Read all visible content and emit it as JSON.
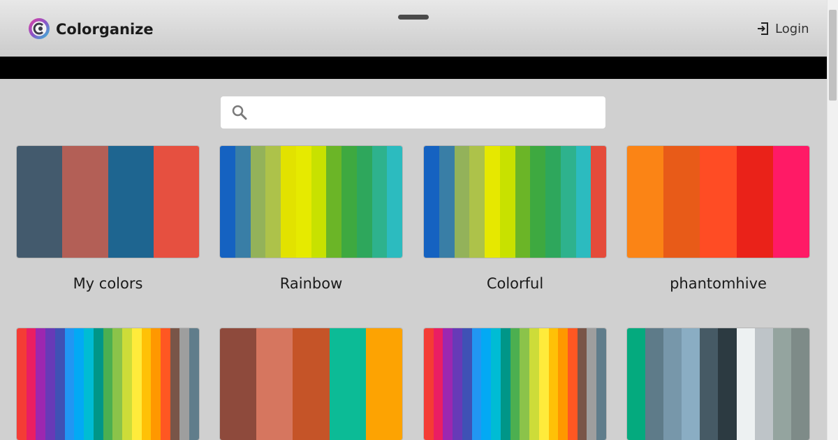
{
  "header": {
    "brand": "Colorganize",
    "login_label": "Login"
  },
  "search": {
    "placeholder": "",
    "value": ""
  },
  "palettes": [
    {
      "name": "My colors",
      "colors": [
        "#435a6d",
        "#b35f56",
        "#1e6590",
        "#e65040"
      ]
    },
    {
      "name": "Rainbow",
      "colors": [
        "#1562c1",
        "#397ea6",
        "#93b25a",
        "#adc24a",
        "#e2e200",
        "#e6ea00",
        "#c8e100",
        "#6bb527",
        "#3ea940",
        "#2ea75c",
        "#2eb28d",
        "#2cbbbf"
      ]
    },
    {
      "name": "Colorful",
      "colors": [
        "#1562c1",
        "#397ea6",
        "#93b25a",
        "#adc24a",
        "#e6e800",
        "#c8e100",
        "#6bb527",
        "#3ea940",
        "#2ea75c",
        "#2eb28d",
        "#2cbbbf",
        "#e54b3a"
      ]
    },
    {
      "name": "phantomhive",
      "colors": [
        "#fb8415",
        "#e85b18",
        "#ff4c24",
        "#ea2219",
        "#ff1a66"
      ]
    },
    {
      "name": "",
      "colors": [
        "#f43c35",
        "#ea1e63",
        "#9c27b0",
        "#673ab7",
        "#3f51b5",
        "#2196f3",
        "#03a9f4",
        "#00bcd4",
        "#009688",
        "#4caf50",
        "#8bc34a",
        "#cddc39",
        "#ffeb3b",
        "#ffc107",
        "#ff9800",
        "#ff5722",
        "#795548",
        "#9e9e9e",
        "#607d8b"
      ]
    },
    {
      "name": "",
      "colors": [
        "#8e4a3c",
        "#d6765f",
        "#c55428",
        "#0cbb96",
        "#fda302"
      ]
    },
    {
      "name": "",
      "colors": [
        "#f43c35",
        "#ea1e63",
        "#9c27b0",
        "#673ab7",
        "#3f51b5",
        "#2196f3",
        "#03a9f4",
        "#00bcd4",
        "#009688",
        "#4caf50",
        "#8bc34a",
        "#cddc39",
        "#ffeb3b",
        "#ffc107",
        "#ff9800",
        "#ff5722",
        "#795548",
        "#9e9e9e",
        "#607d8b"
      ]
    },
    {
      "name": "",
      "colors": [
        "#04aa7e",
        "#5e7b89",
        "#7797aa",
        "#8aadc3",
        "#465a65",
        "#2c3a41",
        "#edf1f2",
        "#bec4c8",
        "#94a49f",
        "#7e8b88"
      ]
    }
  ]
}
